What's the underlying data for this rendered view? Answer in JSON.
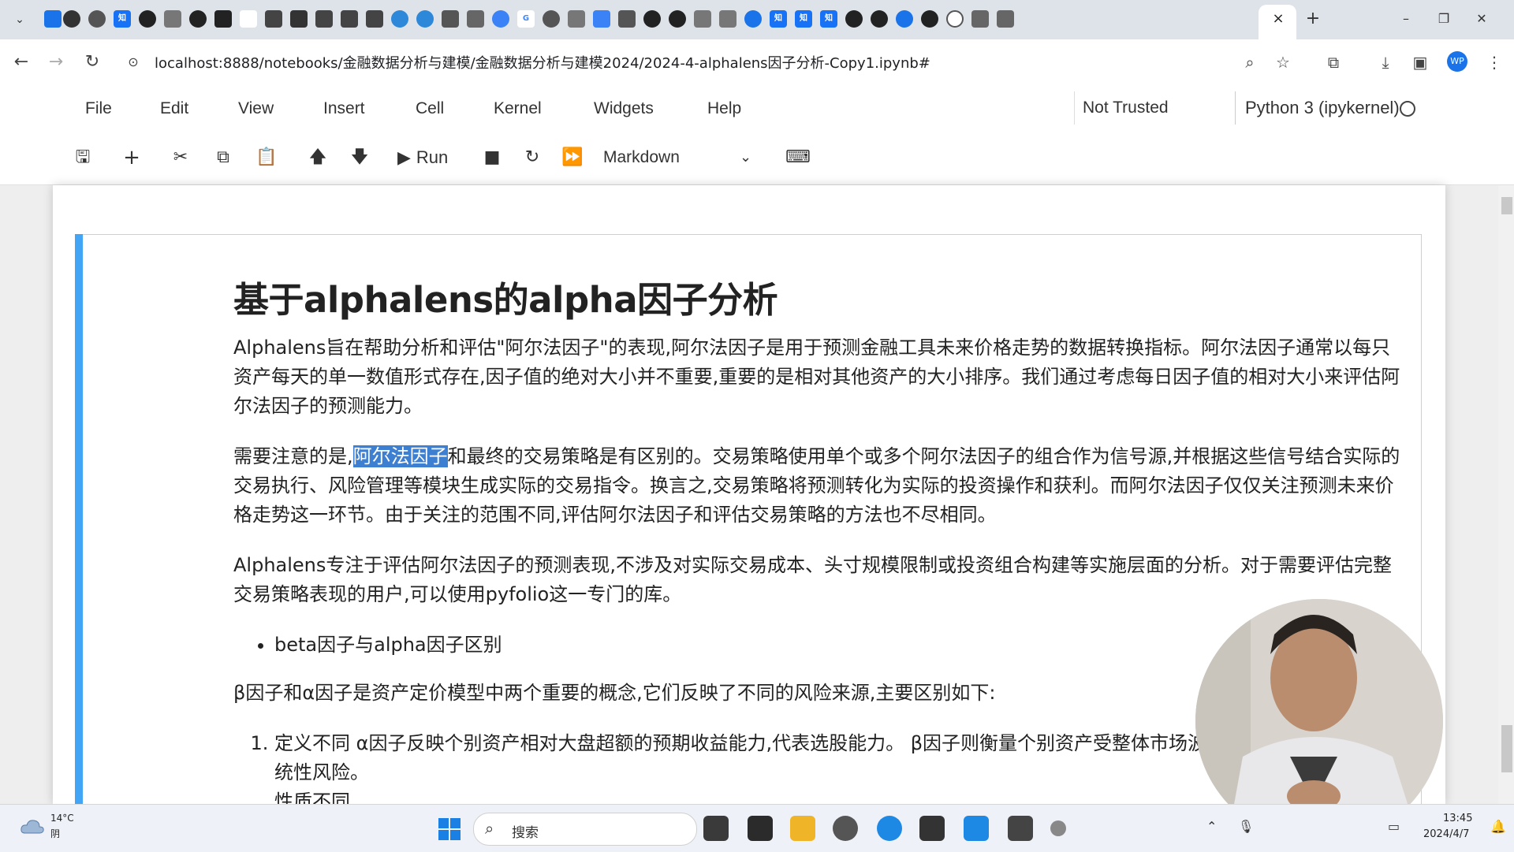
{
  "browser": {
    "tab_close_glyph": "×",
    "new_tab_glyph": "+",
    "tab_icons": [
      "知",
      "G",
      "知",
      "知",
      "知",
      "知"
    ],
    "profile": "WP",
    "url": "localhost:8888/notebooks/金融数据分析与建模/金融数据分析与建模2024/2024-4-alphalens因子分析-Copy1.ipynb#"
  },
  "menubar": {
    "items": [
      "File",
      "Edit",
      "View",
      "Insert",
      "Cell",
      "Kernel",
      "Widgets",
      "Help"
    ],
    "trust": "Not Trusted",
    "kernel": "Python 3 (ipykernel)"
  },
  "toolbar": {
    "run_label": "Run",
    "cell_type": "Markdown"
  },
  "notebook": {
    "title": "基于alphalens的alpha因子分析",
    "p1": "Alphalens旨在帮助分析和评估\"阿尔法因子\"的表现,阿尔法因子是用于预测金融工具未来价格走势的数据转换指标。阿尔法因子通常以每只资产每天的单一数值形式存在,因子值的绝对大小并不重要,重要的是相对其他资产的大小排序。我们通过考虑每日因子值的相对大小来评估阿尔法因子的预测能力。",
    "p2_before": "需要注意的是,",
    "p2_highlight": "阿尔法因子",
    "p2_after": "和最终的交易策略是有区别的。交易策略使用单个或多个阿尔法因子的组合作为信号源,并根据这些信号结合实际的交易执行、风险管理等模块生成实际的交易指令。换言之,交易策略将预测转化为实际的投资操作和获利。而阿尔法因子仅仅关注预测未来价格走势这一环节。由于关注的范围不同,评估阿尔法因子和评估交易策略的方法也不尽相同。",
    "p3": "Alphalens专注于评估阿尔法因子的预测表现,不涉及对实际交易成本、头寸规模限制或投资组合构建等实施层面的分析。对于需要评估完整交易策略表现的用户,可以使用pyfolio这一专门的库。",
    "bullet": "beta因子与alpha因子区别",
    "p4": "β因子和α因子是资产定价模型中两个重要的概念,它们反映了不同的风险来源,主要区别如下:",
    "ol_item1": "定义不同 α因子反映个别资产相对大盘超额的预期收益能力,代表选股能力。 β因子则衡量个别资产受整体市场波动影响的程度,反映系统性风险。",
    "ol_item2": "性质不同"
  },
  "taskbar": {
    "temp": "14°C",
    "weather": "阴",
    "search_placeholder": "搜索",
    "time": "13:45",
    "date": "2024/4/7"
  },
  "colors": {
    "cell_bar": "#42a5f5",
    "highlight": "#3d7fd1",
    "tab_strip": "#dee3ea"
  }
}
